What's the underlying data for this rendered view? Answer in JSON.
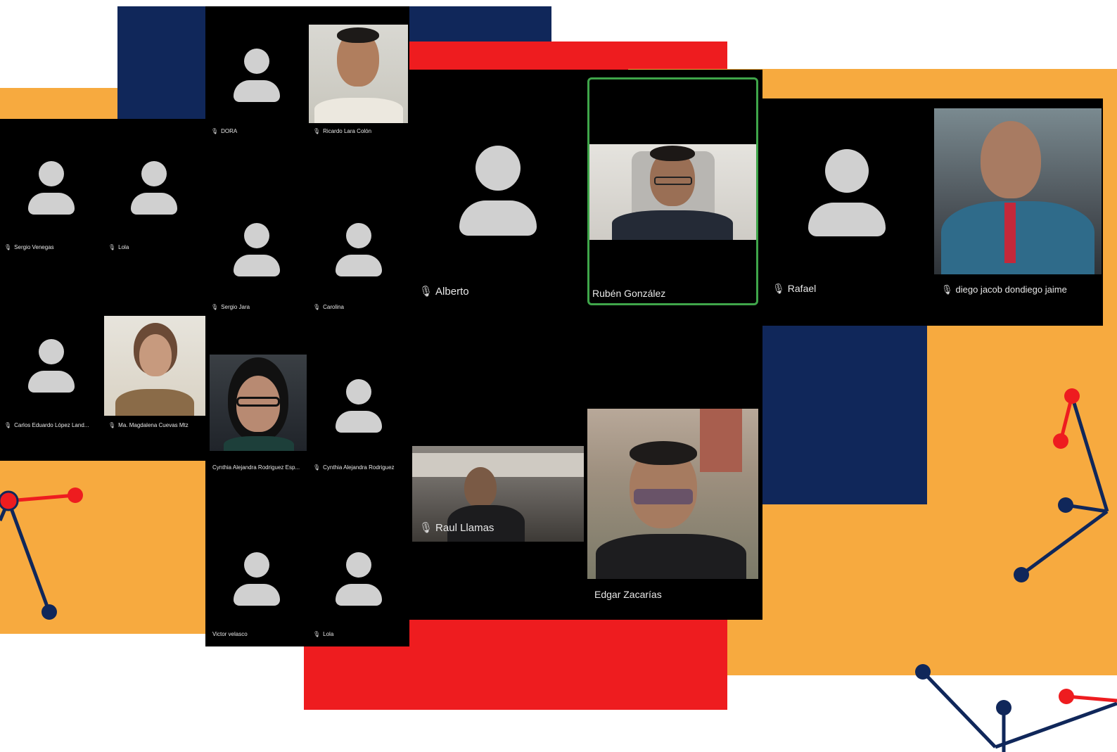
{
  "colors": {
    "navy": "#10275a",
    "red": "#ee1c1f",
    "orange": "#f7aa3f",
    "tile_bg": "#000000",
    "avatar": "#d0d0d0",
    "active_border": "#3fa54a"
  },
  "icons": {
    "mic": "microphone-icon",
    "avatar": "user-avatar-icon"
  },
  "mic_glyph": "🎙",
  "panel_a": {
    "participants": [
      {
        "name": "Sergio Venegas"
      },
      {
        "name": "Lola"
      },
      {
        "name": "Carlos Eduardo López Land..."
      },
      {
        "name": "Ma. Magdalena Cuevas Mtz"
      }
    ]
  },
  "panel_b": {
    "participants": [
      {
        "name": "DORA"
      },
      {
        "name": "Ricardo Lara Colón"
      },
      {
        "name": "Sergio Jara"
      },
      {
        "name": "Carolina"
      },
      {
        "name": "Cynthia Alejandra Rodriguez Esp..."
      },
      {
        "name": "Cynthia Alejandra Rodriguez"
      },
      {
        "name": "Victor velasco"
      },
      {
        "name": "Lola"
      }
    ]
  },
  "panel_c": {
    "participants": [
      {
        "name": "Alberto"
      },
      {
        "name": "Rubén González"
      },
      {
        "name": "Raul Llamas"
      },
      {
        "name": "Edgar Zacarías"
      }
    ]
  },
  "panel_d": {
    "participants": [
      {
        "name": "Rafael"
      },
      {
        "name": "diego jacob dondiego jaime"
      }
    ]
  }
}
